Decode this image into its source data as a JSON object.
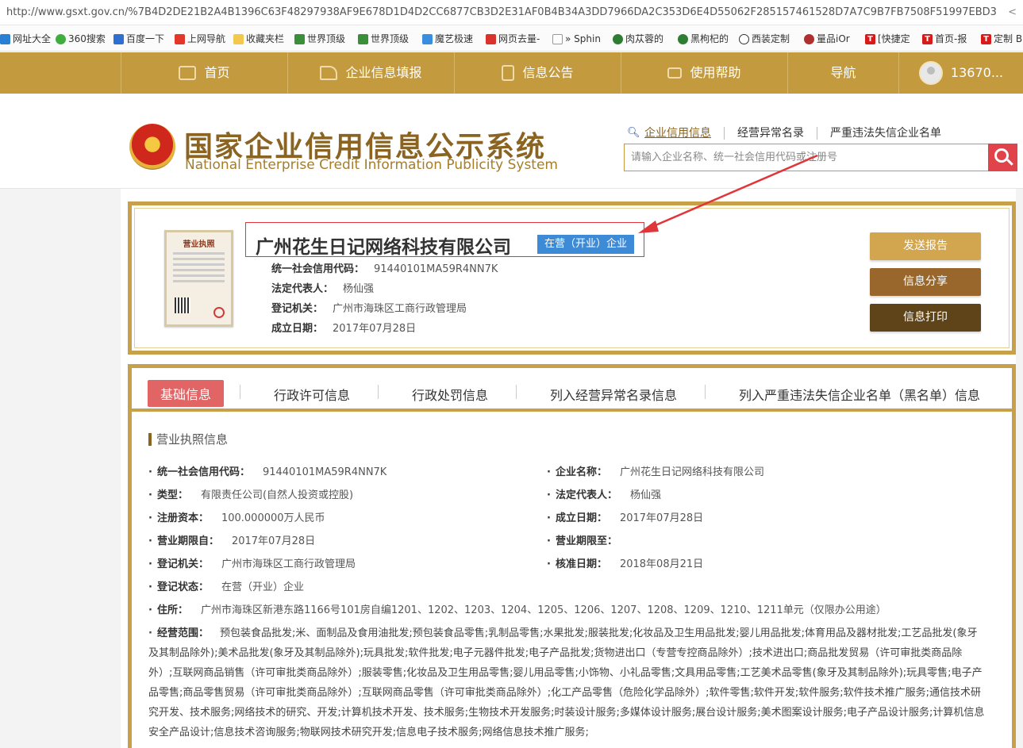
{
  "browser": {
    "url": "http://www.gsxt.gov.cn/%7B4D2DE21B2A4B1396C63F48297938AF9E678D1D4D2CC6877CB3D2E31AF0B4B34A3DD7966DA2C353D6E4D55062F285157461528D7A7C9B7FB7508F51997EBD3",
    "bookmarks": [
      "网址大全",
      "360搜索",
      "百度一下",
      "上网导航",
      "收藏夹栏",
      "世界顶级",
      "世界顶级",
      "魔艺极速",
      "网页去量-",
      "» Sphin",
      "肉苁蓉的",
      "黑枸杞的",
      "西装定制",
      "量品iOr",
      "[快捷定",
      "首页-报",
      "定制 B"
    ]
  },
  "nav": {
    "items": [
      "首页",
      "企业信息填报",
      "信息公告",
      "使用帮助",
      "导航"
    ],
    "user": "13670..."
  },
  "header": {
    "title_cn": "国家企业信用信息公示系统",
    "title_en": "National Enterprise Credit Information Publicity System",
    "search_tabs": [
      "企业信用信息",
      "经营异常名录",
      "严重违法失信企业名单"
    ],
    "search_placeholder": "请输入企业名称、统一社会信用代码或注册号"
  },
  "company": {
    "license_label": "营业执照",
    "name": "广州花生日记网络科技有限公司",
    "status": "在营（开业）企业",
    "credit_code_label": "统一社会信用代码：",
    "credit_code": "91440101MA59R4NN7K",
    "legal_rep_label": "法定代表人：",
    "legal_rep": "杨仙强",
    "reg_authority_label": "登记机关：",
    "reg_authority": "广州市海珠区工商行政管理局",
    "est_date_label": "成立日期：",
    "est_date": "2017年07月28日",
    "buttons": [
      "发送报告",
      "信息分享",
      "信息打印"
    ]
  },
  "tabs": [
    "基础信息",
    "行政许可信息",
    "行政处罚信息",
    "列入经营异常名录信息",
    "列入严重违法失信企业名单（黑名单）信息"
  ],
  "details": {
    "section_title": "营业执照信息",
    "left": [
      {
        "label": "统一社会信用代码：",
        "value": "91440101MA59R4NN7K"
      },
      {
        "label": "类型：",
        "value": "有限责任公司(自然人投资或控股)"
      },
      {
        "label": "注册资本：",
        "value": "100.000000万人民币"
      },
      {
        "label": "营业期限自：",
        "value": "2017年07月28日"
      },
      {
        "label": "登记机关：",
        "value": "广州市海珠区工商行政管理局"
      },
      {
        "label": "登记状态：",
        "value": "在营（开业）企业"
      }
    ],
    "right": [
      {
        "label": "企业名称：",
        "value": "广州花生日记网络科技有限公司"
      },
      {
        "label": "法定代表人：",
        "value": "杨仙强"
      },
      {
        "label": "成立日期：",
        "value": "2017年07月28日"
      },
      {
        "label": "营业期限至：",
        "value": ""
      },
      {
        "label": "核准日期：",
        "value": "2018年08月21日"
      }
    ],
    "address_label": "住所：",
    "address": "广州市海珠区新港东路1166号101房自编1201、1202、1203、1204、1205、1206、1207、1208、1209、1210、1211单元（仅限办公用途）",
    "scope_label": "经营范围：",
    "scope": "预包装食品批发;米、面制品及食用油批发;预包装食品零售;乳制品零售;水果批发;服装批发;化妆品及卫生用品批发;婴儿用品批发;体育用品及器材批发;工艺品批发(象牙及其制品除外);美术品批发(象牙及其制品除外);玩具批发;软件批发;电子元器件批发;电子产品批发;货物进出口（专营专控商品除外）;技术进出口;商品批发贸易（许可审批类商品除外）;互联网商品销售（许可审批类商品除外）;服装零售;化妆品及卫生用品零售;婴儿用品零售;小饰物、小礼品零售;文具用品零售;工艺美术品零售(象牙及其制品除外);玩具零售;电子产品零售;商品零售贸易（许可审批类商品除外）;互联网商品零售（许可审批类商品除外）;化工产品零售（危险化学品除外）;软件零售;软件开发;软件服务;软件技术推广服务;通信技术研究开发、技术服务;网络技术的研究、开发;计算机技术开发、技术服务;生物技术开发服务;时装设计服务;多媒体设计服务;展台设计服务;美术图案设计服务;电子产品设计服务;计算机信息安全产品设计;信息技术咨询服务;物联网技术研究开发;信息电子技术服务;网络信息技术推广服务;"
  }
}
